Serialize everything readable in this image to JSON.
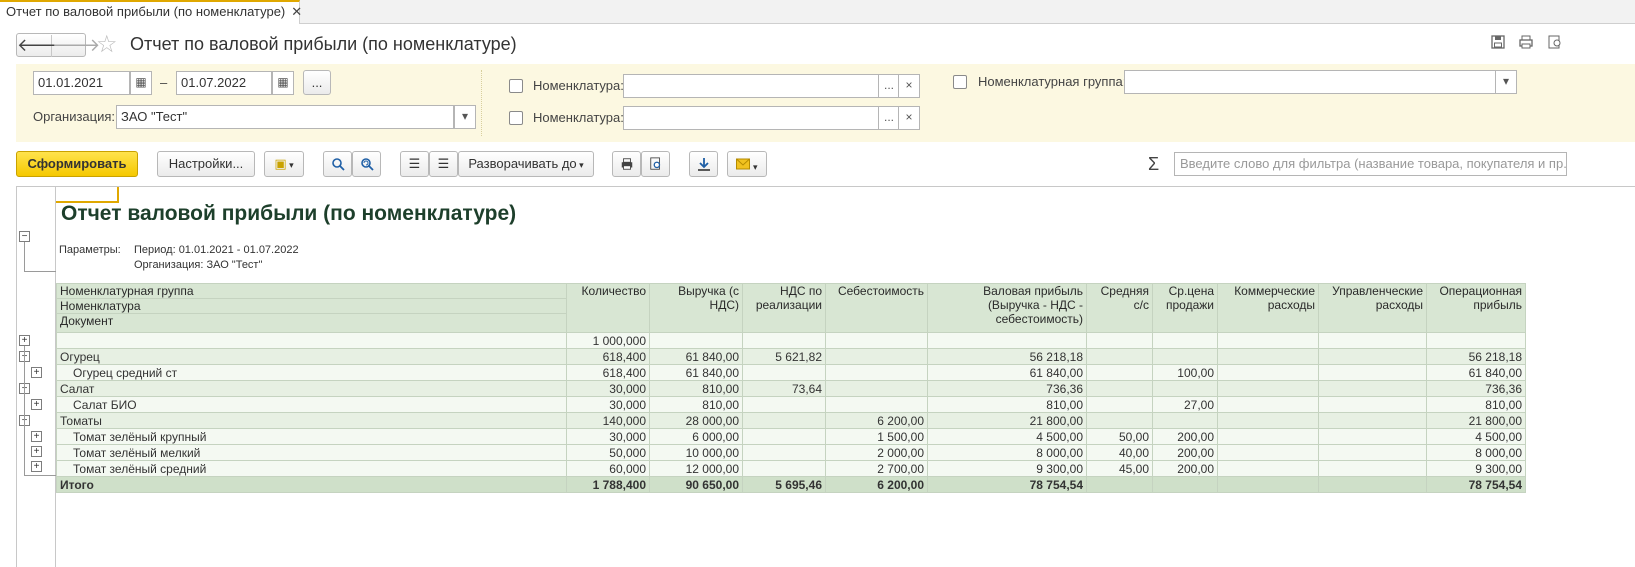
{
  "tab": {
    "label": "Отчет по валовой прибыли (по номенклатуре)",
    "close": "✕"
  },
  "header": {
    "title": "Отчет по валовой прибыли (по номенклатуре)"
  },
  "filters": {
    "date_from": "01.01.2021",
    "date_to": "01.07.2022",
    "dash": "–",
    "more": "...",
    "org_label": "Организация:",
    "org_value": "ЗАО \"Тест\"",
    "nomen_label": "Номенклатура:",
    "nomen_group_label": "Номенклатурная группа:",
    "x": "×"
  },
  "toolbar": {
    "generate": "Сформировать",
    "settings": "Настройки...",
    "expand_to": "Разворачивать до",
    "search_placeholder": "Введите слово для фильтра (название товара, покупателя и пр.)",
    "sigma": "Σ"
  },
  "report": {
    "title": "Отчет валовой прибыли (по номенклатуре)",
    "params_label": "Параметры:",
    "period": "Период: 01.01.2021 - 01.07.2022",
    "org": "Организация: ЗАО \"Тест\"",
    "headers": {
      "h1": "Номенклатурная группа",
      "h2": "Номенклатура",
      "h3": "Документ",
      "qty": "Количество",
      "rev": "Выручка (с НДС)",
      "vat": "НДС по реализации",
      "cost": "Себестоимость",
      "gp": "Валовая прибыль (Выручка - НДС - себестоимость)",
      "avg": "Средняя с/с",
      "price": "Ср.цена продажи",
      "com": "Коммерческие расходы",
      "mgmt": "Управленческие расходы",
      "op": "Операционная прибыль"
    },
    "rows": [
      {
        "name": "",
        "qty": "1 000,000",
        "rev": "",
        "vat": "",
        "cost": "",
        "gp": "",
        "avg": "",
        "price": "",
        "com": "",
        "mgmt": "",
        "op": ""
      },
      {
        "name": "Огурец",
        "qty": "618,400",
        "rev": "61 840,00",
        "vat": "5 621,82",
        "cost": "",
        "gp": "56 218,18",
        "avg": "",
        "price": "",
        "com": "",
        "mgmt": "",
        "op": "56 218,18"
      },
      {
        "name": "Огурец средний ст",
        "qty": "618,400",
        "rev": "61 840,00",
        "vat": "",
        "cost": "",
        "gp": "61 840,00",
        "avg": "",
        "price": "100,00",
        "com": "",
        "mgmt": "",
        "op": "61 840,00"
      },
      {
        "name": "Салат",
        "qty": "30,000",
        "rev": "810,00",
        "vat": "73,64",
        "cost": "",
        "gp": "736,36",
        "avg": "",
        "price": "",
        "com": "",
        "mgmt": "",
        "op": "736,36"
      },
      {
        "name": "Салат БИО",
        "qty": "30,000",
        "rev": "810,00",
        "vat": "",
        "cost": "",
        "gp": "810,00",
        "avg": "",
        "price": "27,00",
        "com": "",
        "mgmt": "",
        "op": "810,00"
      },
      {
        "name": "Томаты",
        "qty": "140,000",
        "rev": "28 000,00",
        "vat": "",
        "cost": "6 200,00",
        "gp": "21 800,00",
        "avg": "",
        "price": "",
        "com": "",
        "mgmt": "",
        "op": "21 800,00"
      },
      {
        "name": "Томат зелёный крупный",
        "qty": "30,000",
        "rev": "6 000,00",
        "vat": "",
        "cost": "1 500,00",
        "gp": "4 500,00",
        "avg": "50,00",
        "price": "200,00",
        "com": "",
        "mgmt": "",
        "op": "4 500,00"
      },
      {
        "name": "Томат зелёный мелкий",
        "qty": "50,000",
        "rev": "10 000,00",
        "vat": "",
        "cost": "2 000,00",
        "gp": "8 000,00",
        "avg": "40,00",
        "price": "200,00",
        "com": "",
        "mgmt": "",
        "op": "8 000,00"
      },
      {
        "name": "Томат зелёный средний",
        "qty": "60,000",
        "rev": "12 000,00",
        "vat": "",
        "cost": "2 700,00",
        "gp": "9 300,00",
        "avg": "45,00",
        "price": "200,00",
        "com": "",
        "mgmt": "",
        "op": "9 300,00"
      },
      {
        "name": "Итого",
        "qty": "1 788,400",
        "rev": "90 650,00",
        "vat": "5 695,46",
        "cost": "6 200,00",
        "gp": "78 754,54",
        "avg": "",
        "price": "",
        "com": "",
        "mgmt": "",
        "op": "78 754,54"
      }
    ]
  },
  "colors": {
    "accent": "#f5c800",
    "header_bg": "#d8e6d3",
    "title": "#1d3f2b",
    "filter_bg": "#fcf8e1"
  }
}
